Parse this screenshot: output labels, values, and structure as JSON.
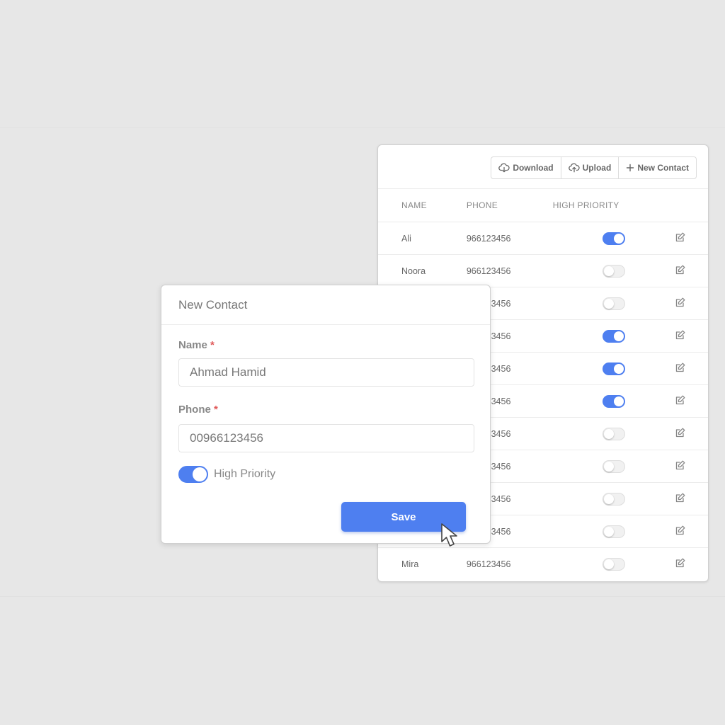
{
  "toolbar": {
    "download_label": "Download",
    "upload_label": "Upload",
    "new_contact_label": "New Contact"
  },
  "table": {
    "headers": {
      "name": "NAME",
      "phone": "PHONE",
      "priority": "HIGH PRIORITY"
    },
    "rows": [
      {
        "name": "Ali",
        "phone": "966123456",
        "high_priority": true
      },
      {
        "name": "Noora",
        "phone": "966123456",
        "high_priority": false
      },
      {
        "name": "",
        "phone": "966123456",
        "high_priority": false
      },
      {
        "name": "",
        "phone": "966123456",
        "high_priority": true
      },
      {
        "name": "",
        "phone": "966123456",
        "high_priority": true
      },
      {
        "name": "",
        "phone": "966123456",
        "high_priority": true
      },
      {
        "name": "",
        "phone": "966123456",
        "high_priority": false
      },
      {
        "name": "",
        "phone": "966123456",
        "high_priority": false
      },
      {
        "name": "",
        "phone": "966123456",
        "high_priority": false
      },
      {
        "name": "",
        "phone": "966123456",
        "high_priority": false
      },
      {
        "name": "Mira",
        "phone": "966123456",
        "high_priority": false
      }
    ]
  },
  "modal": {
    "title": "New Contact",
    "name_label": "Name",
    "phone_label": "Phone",
    "required_mark": "*",
    "name_value": "Ahmad Hamid",
    "phone_value": "00966123456",
    "high_priority_label": "High Priority",
    "high_priority": true,
    "save_label": "Save"
  },
  "colors": {
    "accent": "#4e7ff0",
    "required": "#e05a5a",
    "background": "#e7e7e7"
  },
  "icons": {
    "download": "cloud-download-icon",
    "upload": "cloud-upload-icon",
    "new_contact": "plus-icon",
    "edit": "edit-icon",
    "cursor": "mouse-pointer-icon"
  }
}
